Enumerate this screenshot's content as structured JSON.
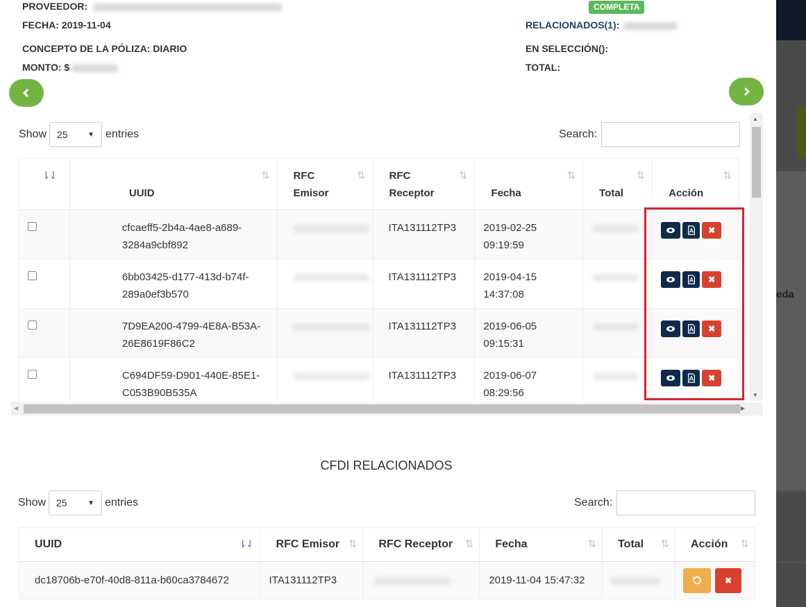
{
  "header": {
    "proveedor_label": "PROVEEDOR:",
    "fecha_label": "FECHA:",
    "fecha_value": "2019-11-04",
    "concepto_label": "CONCEPTO DE LA PÓLIZA:",
    "concepto_value": "DIARIO",
    "monto_label": "MONTO: $",
    "status_badge": "COMPLETA",
    "relacionados_label": "RELACIONADOS(1):",
    "seleccion_label": "EN SELECCIÓN():",
    "total_label": "TOTAL:"
  },
  "nav": {
    "prev_icon": "chevron-left-icon",
    "next_icon": "chevron-right-icon"
  },
  "table1": {
    "show_label": "Show",
    "entries_value": "25",
    "entries_label": "entries",
    "search_label": "Search:",
    "search_value": "",
    "columns": [
      {
        "line1": "",
        "line2": "UUID"
      },
      {
        "line1": "RFC",
        "line2": "Emisor"
      },
      {
        "line1": "RFC",
        "line2": "Receptor"
      },
      {
        "line1": "",
        "line2": "Fecha"
      },
      {
        "line1": "",
        "line2": "Total"
      },
      {
        "line1": "",
        "line2": "Acción"
      }
    ],
    "rows": [
      {
        "uuid1": "cfcaeff5-2b4a-4ae8-a689-",
        "uuid2": "3284a9cbf892",
        "receptor": "ITA131112TP3",
        "fecha1": "2019-02-25",
        "fecha2": "09:19:59"
      },
      {
        "uuid1": "6bb03425-d177-413d-b74f-",
        "uuid2": "289a0ef3b570",
        "receptor": "ITA131112TP3",
        "fecha1": "2019-04-15",
        "fecha2": "14:37:08"
      },
      {
        "uuid1": "7D9EA200-4799-4E8A-B53A-",
        "uuid2": "26E8619F86C2",
        "receptor": "ITA131112TP3",
        "fecha1": "2019-06-05",
        "fecha2": "09:15:31"
      },
      {
        "uuid1": "C694DF59-D901-440E-85E1-",
        "uuid2": "C053B90B535A",
        "receptor": "ITA131112TP3",
        "fecha1": "2019-06-07",
        "fecha2": "08:29:56"
      }
    ],
    "action_icons": [
      "eye-icon",
      "pdf-icon",
      "close-icon"
    ]
  },
  "section2": {
    "title": "CFDI RELACIONADOS"
  },
  "table2": {
    "show_label": "Show",
    "entries_value": "25",
    "entries_label": "entries",
    "search_label": "Search:",
    "search_value": "",
    "columns": [
      "UUID",
      "RFC Emisor",
      "RFC Receptor",
      "Fecha",
      "Total",
      "Acción"
    ],
    "rows": [
      {
        "uuid": "dc18706b-e70f-40d8-811a-b60ca3784672",
        "emisor": "ITA131112TP3",
        "fecha": "2019-11-04 15:47:32"
      }
    ],
    "action_icons": [
      "undo-icon",
      "close-icon"
    ]
  },
  "colors": {
    "accent_green": "#72b544",
    "navy": "#0e2a4a",
    "danger": "#d9412f",
    "warning": "#f0ad4e",
    "highlight_box": "#d8232f"
  }
}
